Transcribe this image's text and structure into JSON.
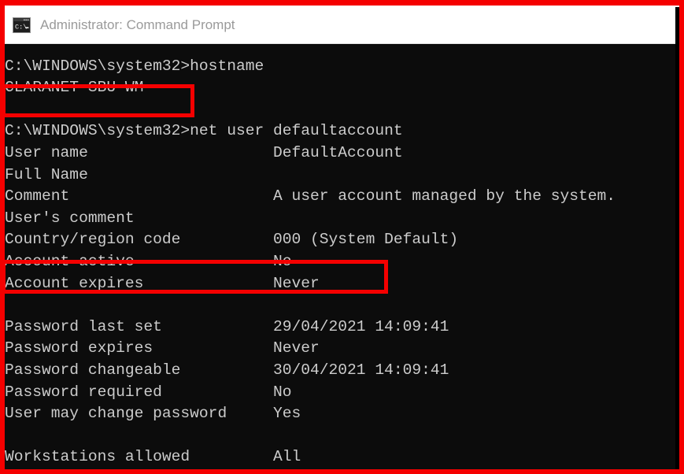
{
  "window": {
    "title": "Administrator: Command Prompt",
    "icon": "command-prompt-icon",
    "titlebar_bg": "#ffffff",
    "title_color": "#9a9a9a",
    "console_bg": "#0c0c0c",
    "console_fg": "#cccccc"
  },
  "annotation": {
    "color": "#f50000",
    "boxes": [
      {
        "name": "hostname-result-highlight",
        "target": "CLARANET-SBU-WM"
      },
      {
        "name": "account-active-highlight",
        "target": "Account active No"
      },
      {
        "name": "screenshot-outer-frame",
        "target": "entire capture"
      }
    ]
  },
  "clipped_top_row": "·  ···   ·· ··  ·   ·  ·   ·· ·  ·  ·· ·",
  "console": {
    "lines": [
      {
        "text": ""
      },
      {
        "text": "C:\\WINDOWS\\system32>hostname"
      },
      {
        "text": "CLARANET-SBU-WM"
      },
      {
        "text": ""
      },
      {
        "text": "C:\\WINDOWS\\system32>net user defaultaccount"
      },
      {
        "label": "User name",
        "value": "DefaultAccount"
      },
      {
        "label": "Full Name",
        "value": ""
      },
      {
        "label": "Comment",
        "value": "A user account managed by the system."
      },
      {
        "label": "User's comment",
        "value": ""
      },
      {
        "label": "Country/region code",
        "value": "000 (System Default)"
      },
      {
        "label": "Account active",
        "value": "No"
      },
      {
        "label": "Account expires",
        "value": "Never"
      },
      {
        "text": ""
      },
      {
        "label": "Password last set",
        "value": "29/04/2021 14:09:41"
      },
      {
        "label": "Password expires",
        "value": "Never"
      },
      {
        "label": "Password changeable",
        "value": "30/04/2021 14:09:41"
      },
      {
        "label": "Password required",
        "value": "No"
      },
      {
        "label": "User may change password",
        "value": "Yes"
      },
      {
        "text": ""
      },
      {
        "label": "Workstations allowed",
        "value": "All"
      }
    ]
  }
}
